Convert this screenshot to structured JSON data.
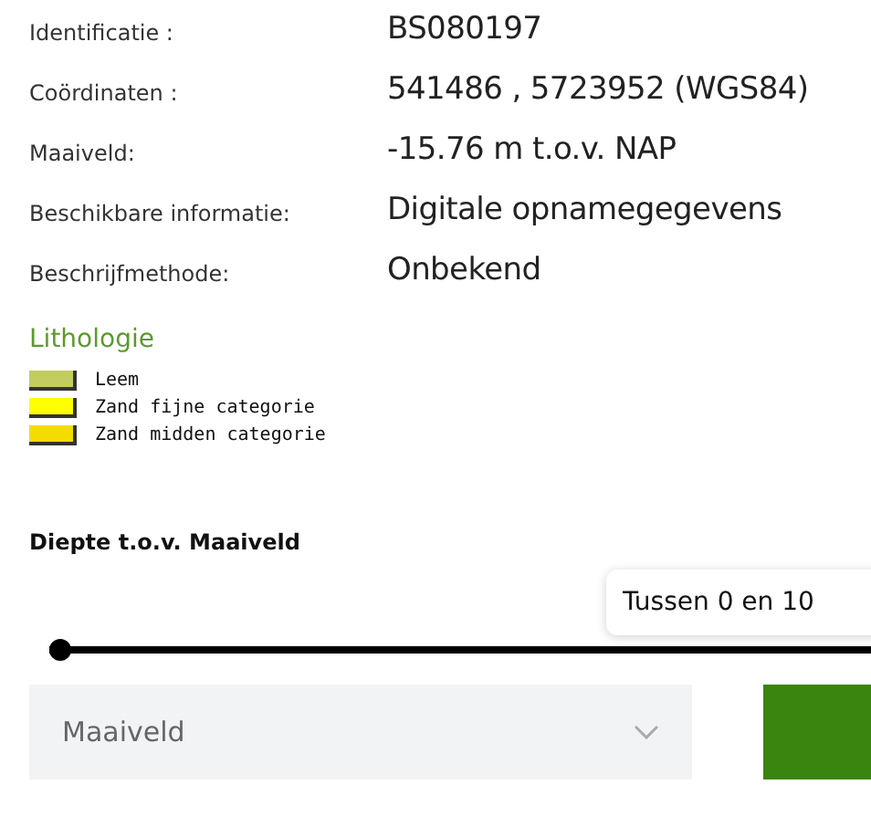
{
  "details": [
    {
      "label": "Identificatie :",
      "value": "BS080197"
    },
    {
      "label": "Coördinaten :",
      "value": "541486 , 5723952 (WGS84)"
    },
    {
      "label": "Maaiveld:",
      "value": "-15.76 m t.o.v. NAP"
    },
    {
      "label": "Beschikbare informatie:",
      "value": "Digitale opnamegegevens"
    },
    {
      "label": "Beschrijfmethode:",
      "value": "Onbekend"
    }
  ],
  "lithology": {
    "title": "Lithologie",
    "items": [
      {
        "label": "Leem",
        "color": "#c3cc5e"
      },
      {
        "label": "Zand fijne categorie",
        "color": "#ffff00"
      },
      {
        "label": "Zand midden categorie",
        "color": "#f3dd00"
      }
    ]
  },
  "depth": {
    "title": "Diepte t.o.v. Maaiveld",
    "tooltip": "Tussen 0 en 10",
    "level": 0
  },
  "select": {
    "value": "Maaiveld"
  }
}
